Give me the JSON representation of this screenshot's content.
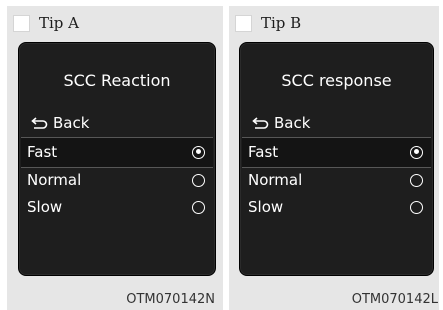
{
  "panels": [
    {
      "tip_label": "Tip A",
      "screen_title": "SCC Reaction",
      "back_label": "Back",
      "options": [
        {
          "label": "Fast",
          "selected": true
        },
        {
          "label": "Normal",
          "selected": false
        },
        {
          "label": "Slow",
          "selected": false
        }
      ],
      "code": "OTM070142N"
    },
    {
      "tip_label": "Tip B",
      "screen_title": "SCC response",
      "back_label": "Back",
      "options": [
        {
          "label": "Fast",
          "selected": true
        },
        {
          "label": "Normal",
          "selected": false
        },
        {
          "label": "Slow",
          "selected": false
        }
      ],
      "code": "OTM070142L"
    }
  ],
  "colors": {
    "panel_bg": "#e6e6e6",
    "screen_bg": "#1e1e1e",
    "text": "#ffffff"
  },
  "icons": {
    "back": "back-arrow-icon",
    "radio_on": "radio-selected-icon",
    "radio_off": "radio-unselected-icon"
  }
}
